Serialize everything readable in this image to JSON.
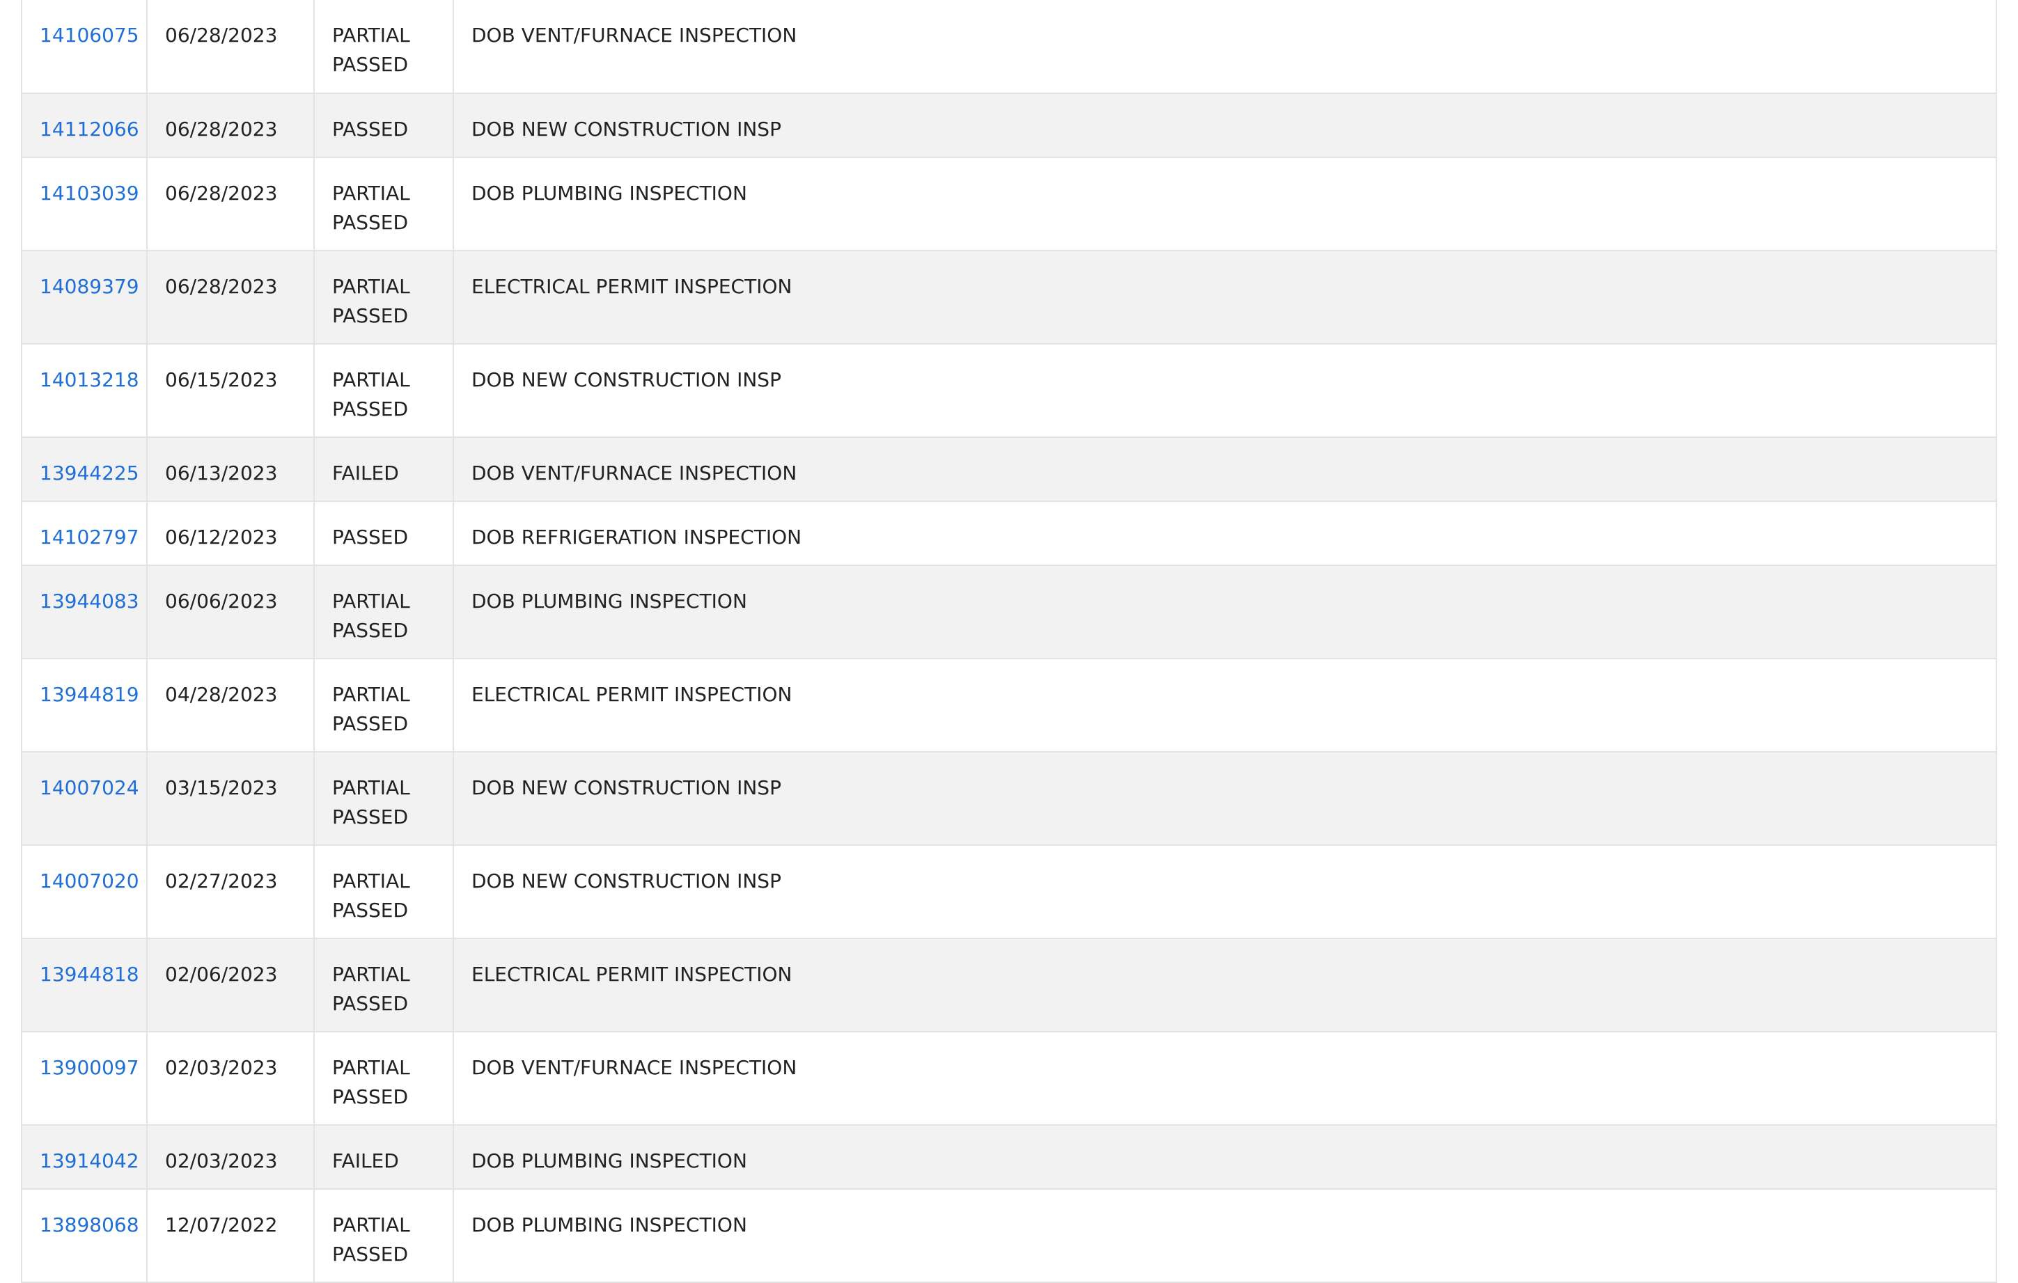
{
  "inspections": [
    {
      "id": "14106075",
      "date": "06/28/2023",
      "result": "PARTIAL PASSED",
      "type": "DOB VENT/FURNACE INSPECTION"
    },
    {
      "id": "14112066",
      "date": "06/28/2023",
      "result": "PASSED",
      "type": "DOB NEW CONSTRUCTION INSP"
    },
    {
      "id": "14103039",
      "date": "06/28/2023",
      "result": "PARTIAL PASSED",
      "type": "DOB PLUMBING INSPECTION"
    },
    {
      "id": "14089379",
      "date": "06/28/2023",
      "result": "PARTIAL PASSED",
      "type": "ELECTRICAL PERMIT INSPECTION"
    },
    {
      "id": "14013218",
      "date": "06/15/2023",
      "result": "PARTIAL PASSED",
      "type": "DOB NEW CONSTRUCTION INSP"
    },
    {
      "id": "13944225",
      "date": "06/13/2023",
      "result": "FAILED",
      "type": "DOB VENT/FURNACE INSPECTION"
    },
    {
      "id": "14102797",
      "date": "06/12/2023",
      "result": "PASSED",
      "type": "DOB REFRIGERATION INSPECTION"
    },
    {
      "id": "13944083",
      "date": "06/06/2023",
      "result": "PARTIAL PASSED",
      "type": "DOB PLUMBING INSPECTION"
    },
    {
      "id": "13944819",
      "date": "04/28/2023",
      "result": "PARTIAL PASSED",
      "type": "ELECTRICAL PERMIT INSPECTION"
    },
    {
      "id": "14007024",
      "date": "03/15/2023",
      "result": "PARTIAL PASSED",
      "type": "DOB NEW CONSTRUCTION INSP"
    },
    {
      "id": "14007020",
      "date": "02/27/2023",
      "result": "PARTIAL PASSED",
      "type": "DOB NEW CONSTRUCTION INSP"
    },
    {
      "id": "13944818",
      "date": "02/06/2023",
      "result": "PARTIAL PASSED",
      "type": "ELECTRICAL PERMIT INSPECTION"
    },
    {
      "id": "13900097",
      "date": "02/03/2023",
      "result": "PARTIAL PASSED",
      "type": "DOB VENT/FURNACE INSPECTION"
    },
    {
      "id": "13914042",
      "date": "02/03/2023",
      "result": "FAILED",
      "type": "DOB PLUMBING INSPECTION"
    },
    {
      "id": "13898068",
      "date": "12/07/2022",
      "result": "PARTIAL PASSED",
      "type": "DOB PLUMBING INSPECTION"
    }
  ],
  "colors": {
    "link": "#1f6fd6",
    "stripe": "#f2f2f2",
    "border": "#e3e3e3",
    "text": "#222222"
  }
}
